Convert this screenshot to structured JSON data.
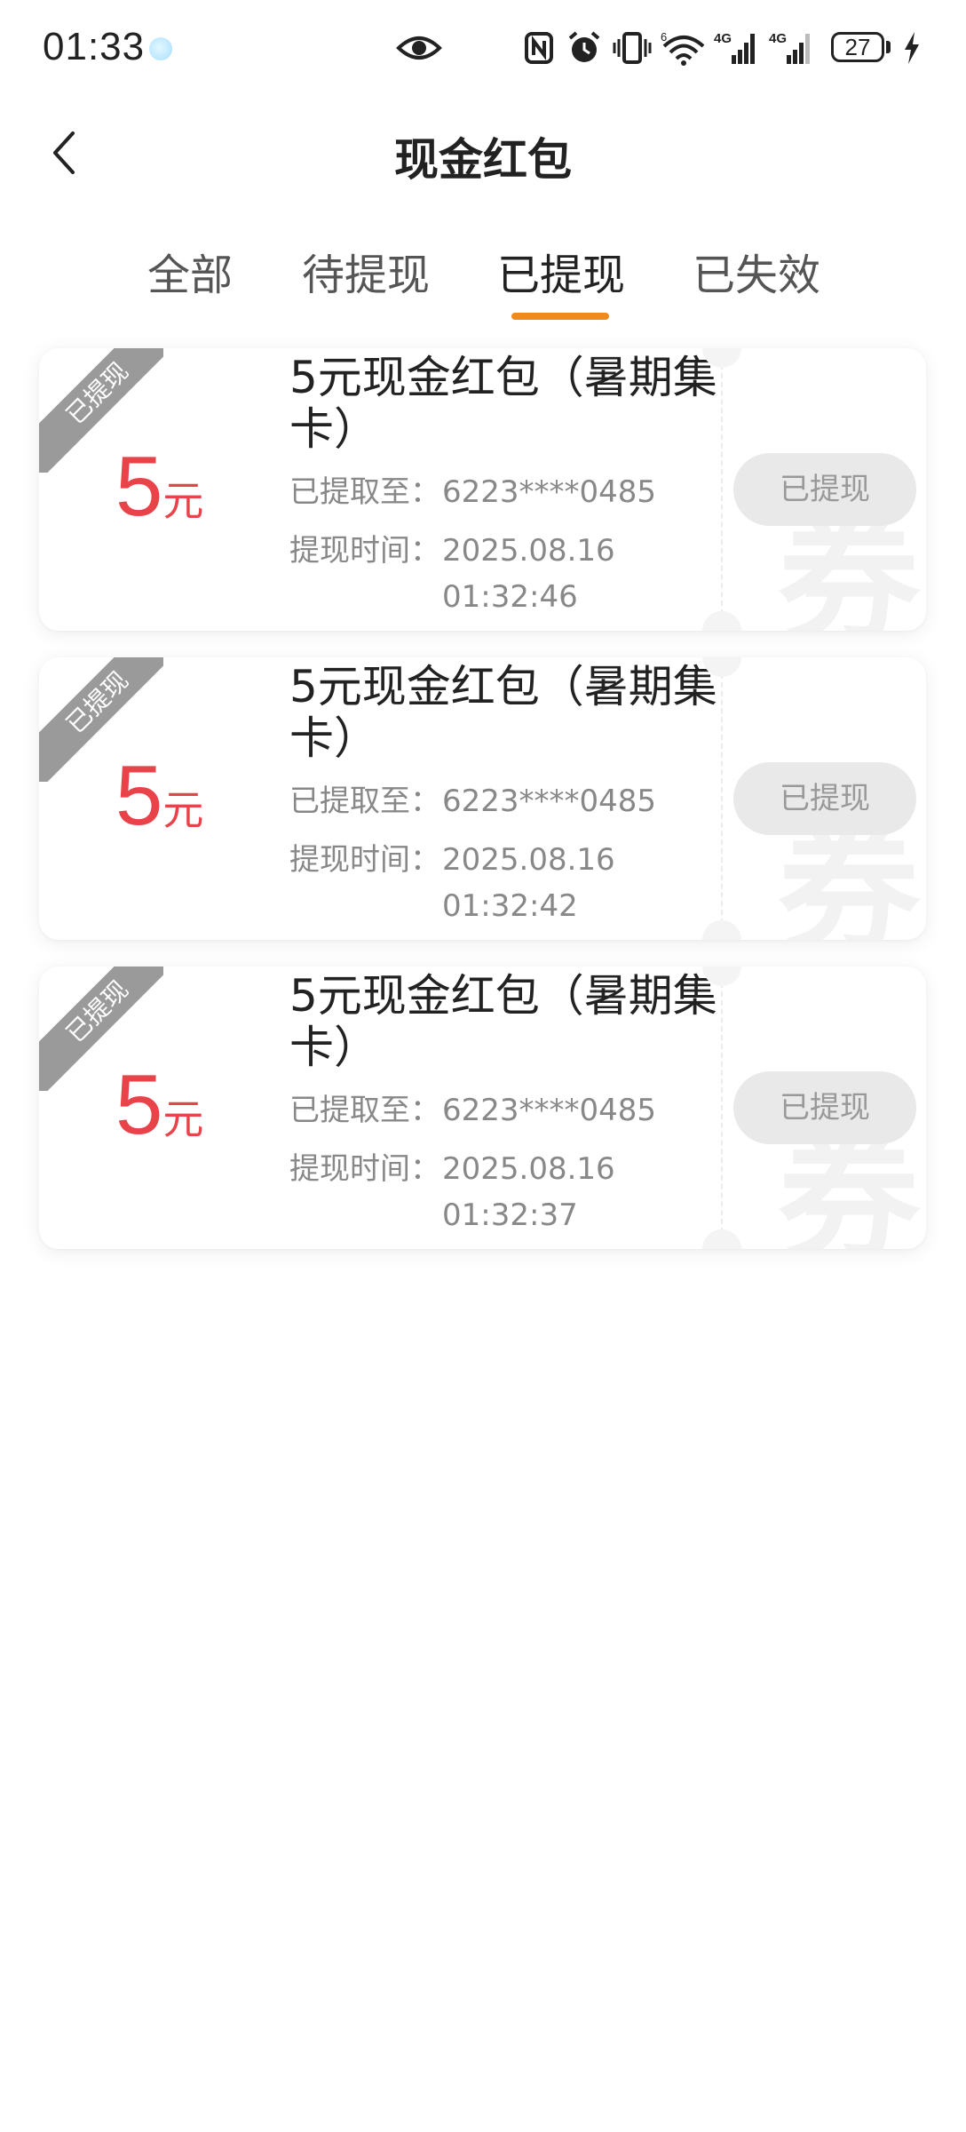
{
  "status_bar": {
    "time": "01:33",
    "battery": "27",
    "icons": [
      "eye-icon",
      "nfc-icon",
      "alarm-icon",
      "vibrate-icon",
      "wifi-icon",
      "signal-4g-icon",
      "signal-4g-icon",
      "charging-icon"
    ],
    "network_label_1": "4G",
    "network_label_2": "4G",
    "wifi_label": "6"
  },
  "header": {
    "title": "现金红包",
    "back_icon": "chevron-left-icon"
  },
  "tabs": [
    {
      "label": "全部",
      "active": false
    },
    {
      "label": "待提现",
      "active": false
    },
    {
      "label": "已提现",
      "active": true
    },
    {
      "label": "已失效",
      "active": false
    }
  ],
  "colors": {
    "accent": "#f08a1d",
    "amount": "#e9434a",
    "ribbon": "#9a9a9a",
    "button_bg": "#e9e9e9"
  },
  "cards": [
    {
      "ribbon": "已提现",
      "amount": "5",
      "unit": "元",
      "title": "5元现金红包（暑期集卡）",
      "withdraw_label": "已提取至：",
      "withdraw_value": "6223****0485",
      "time_label": "提现时间：",
      "time_value": "2025.08.16 01:32:46",
      "button": "已提现",
      "watermark": "券"
    },
    {
      "ribbon": "已提现",
      "amount": "5",
      "unit": "元",
      "title": "5元现金红包（暑期集卡）",
      "withdraw_label": "已提取至：",
      "withdraw_value": "6223****0485",
      "time_label": "提现时间：",
      "time_value": "2025.08.16 01:32:42",
      "button": "已提现",
      "watermark": "券"
    },
    {
      "ribbon": "已提现",
      "amount": "5",
      "unit": "元",
      "title": "5元现金红包（暑期集卡）",
      "withdraw_label": "已提取至：",
      "withdraw_value": "6223****0485",
      "time_label": "提现时间：",
      "time_value": "2025.08.16 01:32:37",
      "button": "已提现",
      "watermark": "券"
    }
  ]
}
